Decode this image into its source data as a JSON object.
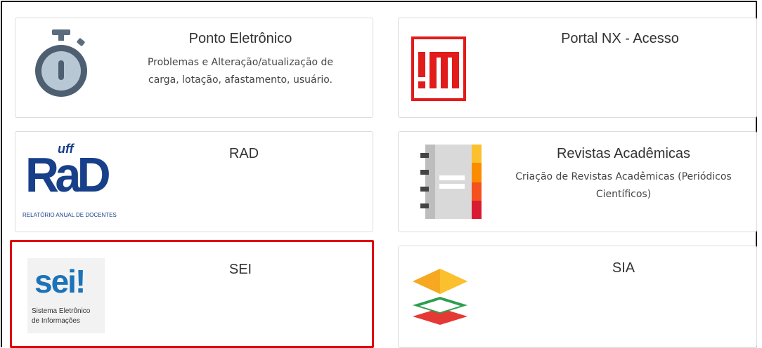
{
  "cards": [
    {
      "title": "Ponto Eletrônico",
      "description": "Problemas e Alteração/atualização de carga, lotação, afastamento, usuário.",
      "icon": "stopwatch-icon"
    },
    {
      "title": "Portal NX - Acesso",
      "description": "",
      "icon": "im-logo-icon"
    },
    {
      "title": "RAD",
      "description": "",
      "icon": "rad-logo",
      "logo_text": {
        "top": "uff",
        "main": "RaD",
        "caption": "RELATÓRIO ANUAL DE DOCENTES"
      }
    },
    {
      "title": "Revistas Acadêmicas",
      "description": "Criação de Revistas Acadêmicas (Periódicos Científicos)",
      "icon": "notebook-icon"
    },
    {
      "title": "SEI",
      "description": "",
      "icon": "sei-logo",
      "selected": true,
      "logo_text": {
        "main": "sei!",
        "line1": "Sistema Eletrônico",
        "line2": "de Informações"
      }
    },
    {
      "title": "SIA",
      "description": "",
      "icon": "layers-icon"
    }
  ],
  "colors": {
    "accent_red": "#e00000",
    "rad_blue": "#173f8a",
    "sei_blue": "#1c73b8",
    "sei_green": "#8cc63f"
  }
}
